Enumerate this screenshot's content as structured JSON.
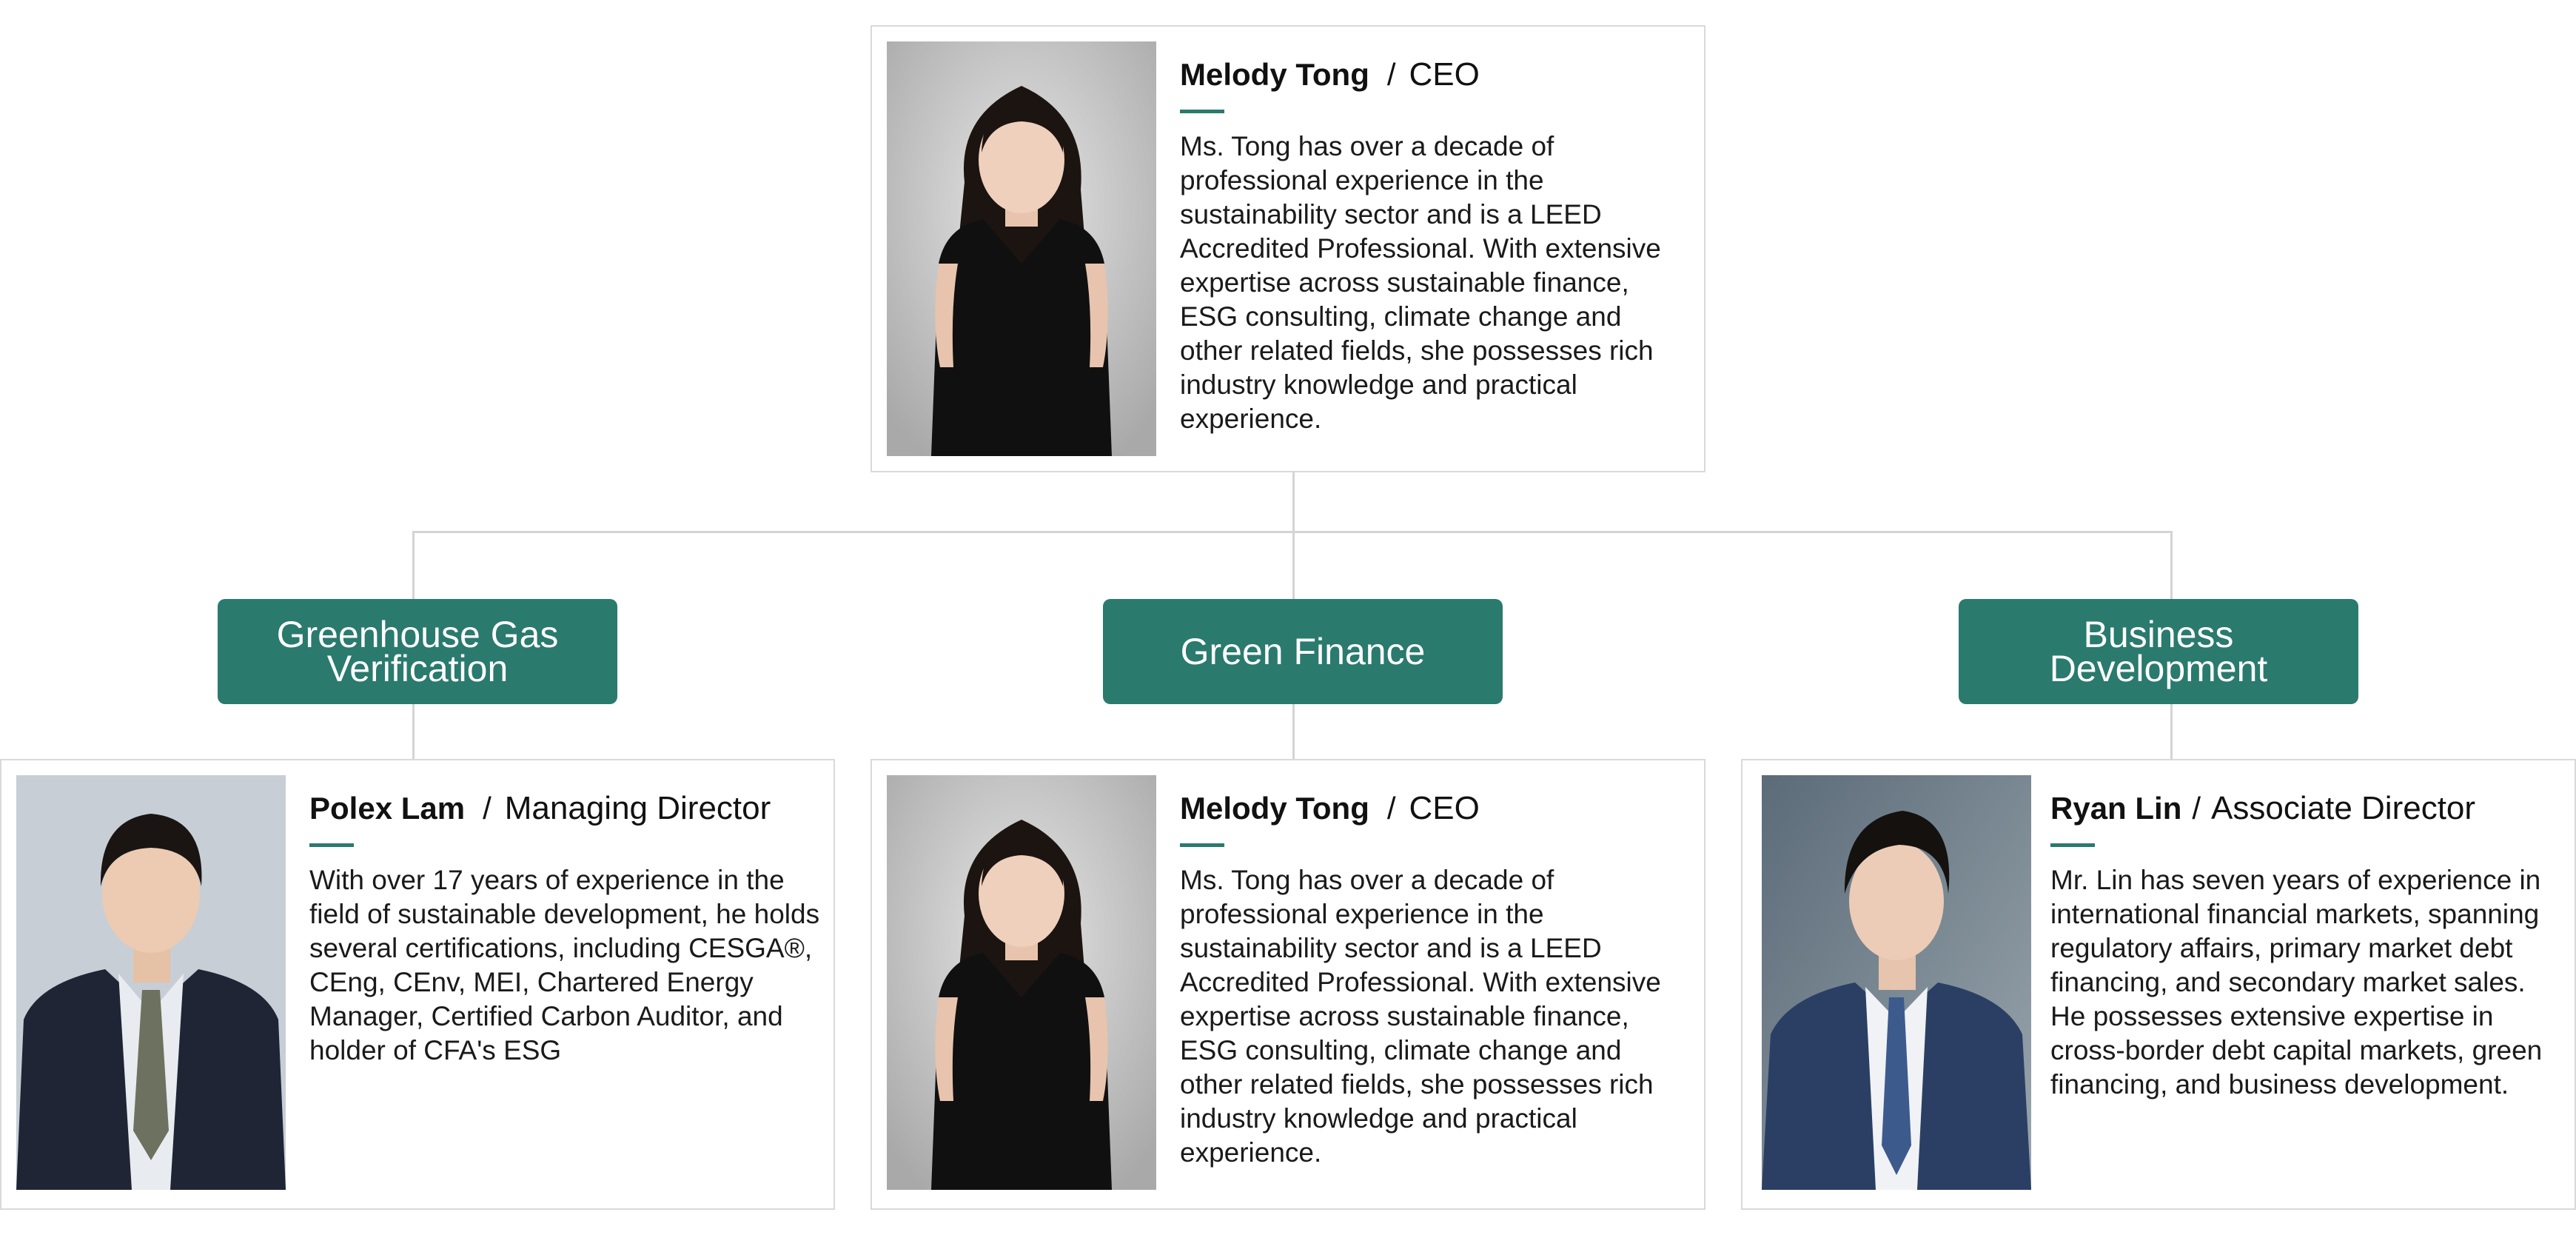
{
  "top": {
    "name": "Melody Tong",
    "role": "CEO",
    "bio": "Ms. Tong has over a decade of professional experience in the sustainability sector and is a LEED Accredited Professional. With extensive expertise across sustainable finance, ESG consulting, climate change and other related fields, she possesses rich industry knowledge and practical experience."
  },
  "departments": [
    {
      "label": "Greenhouse Gas Verification"
    },
    {
      "label": "Green Finance"
    },
    {
      "label": "Business Development"
    }
  ],
  "members": [
    {
      "name": "Polex Lam",
      "role": "Managing Director",
      "bio": "With over 17 years of experience in the field of sustainable development, he holds several certifications, including CESGA®, CEng, CEnv, MEI, Chartered Energy Manager, Certified Carbon Auditor, and holder of CFA's ESG"
    },
    {
      "name": "Melody Tong",
      "role": "CEO",
      "bio": "Ms. Tong has over a decade of professional experience in the sustainability sector and is a LEED Accredited Professional. With extensive expertise across sustainable finance, ESG consulting, climate change and other related fields, she possesses rich industry knowledge and practical experience."
    },
    {
      "name": "Ryan Lin",
      "role": "Associate Director",
      "bio": "Mr. Lin has seven years of experience in international financial markets, spanning regulatory affairs, primary market debt financing, and secondary market sales. He possesses extensive expertise in cross-border debt capital markets, green financing, and business development."
    }
  ],
  "colors": {
    "accent": "#2a7a6e",
    "connector": "#d4d4d4",
    "card_border": "#d9d9d9"
  }
}
